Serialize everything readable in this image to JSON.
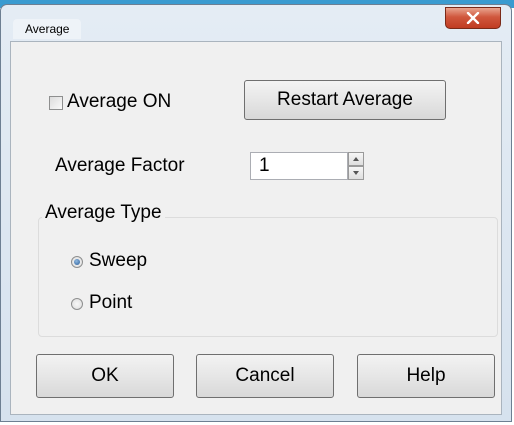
{
  "window": {
    "title": "Average"
  },
  "controls": {
    "average_on_label": "Average ON",
    "average_on_checked": false,
    "restart_average_label": "Restart Average",
    "average_factor_label": "Average Factor",
    "average_factor_value": "1"
  },
  "average_type": {
    "legend": "Average Type",
    "options": [
      {
        "label": "Sweep",
        "selected": true
      },
      {
        "label": "Point",
        "selected": false
      }
    ]
  },
  "buttons": {
    "ok_label": "OK",
    "cancel_label": "Cancel",
    "help_label": "Help"
  },
  "icons": {
    "close": "close-icon",
    "spin_up": "triangle-up-icon",
    "spin_down": "triangle-down-icon"
  },
  "colors": {
    "window_chrome": "#d6e2ee",
    "close_button": "#c84a30",
    "dialog_background": "#f0f0f0",
    "radio_selected": "#2a5e9a"
  }
}
